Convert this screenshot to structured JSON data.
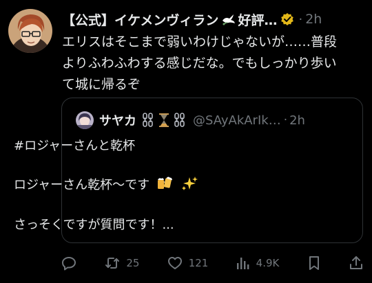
{
  "author": {
    "name": "【公式】イケメンヴィラン",
    "name_suffix": "好評…",
    "time": "2h",
    "separator": "·"
  },
  "post": {
    "text": "エリスはそこまで弱いわけじゃないが……普段\nよりふわふわする感じだな。でもしっかり歩い\nて城に帰るぞ"
  },
  "quote": {
    "name": "サヤカ",
    "handle": "@SAyAkArIk…",
    "separator": "·",
    "time": "2h",
    "line1": "#ロジャーさんと乾杯",
    "line2": "ロジャーさん乾杯〜です",
    "line3": "さっそくですが質問です！..."
  },
  "actions": {
    "retweets": "25",
    "likes": "121",
    "views": "4.9K"
  },
  "colors": {
    "background": "#000000",
    "text": "#e7e9ea",
    "muted": "#71767b",
    "border": "#2f3336",
    "verified": "#e2b719"
  }
}
